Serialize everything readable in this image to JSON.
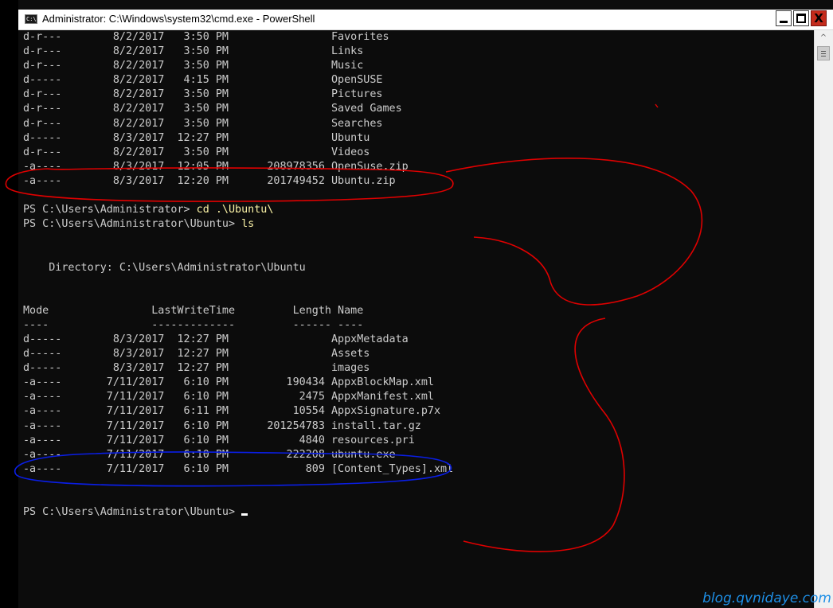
{
  "window": {
    "title": "Administrator: C:\\Windows\\system32\\cmd.exe - PowerShell",
    "title_icon_text": "C:\\",
    "close_glyph": "X"
  },
  "console": {
    "lines": [
      {
        "text": "d-r---        8/2/2017   3:50 PM                Favorites"
      },
      {
        "text": "d-r---        8/2/2017   3:50 PM                Links"
      },
      {
        "text": "d-r---        8/2/2017   3:50 PM                Music"
      },
      {
        "text": "d-----        8/2/2017   4:15 PM                OpenSUSE"
      },
      {
        "text": "d-r---        8/2/2017   3:50 PM                Pictures"
      },
      {
        "text": "d-r---        8/2/2017   3:50 PM                Saved Games"
      },
      {
        "text": "d-r---        8/2/2017   3:50 PM                Searches"
      },
      {
        "text": "d-----        8/3/2017  12:27 PM                Ubuntu"
      },
      {
        "text": "d-r---        8/2/2017   3:50 PM                Videos"
      },
      {
        "text": "-a----        8/3/2017  12:05 PM      208978356 OpenSuse.zip"
      },
      {
        "text": "-a----        8/3/2017  12:20 PM      201749452 Ubuntu.zip"
      },
      {
        "text": ""
      },
      {
        "text": "",
        "prompt": "PS C:\\Users\\Administrator> ",
        "command": "cd .\\Ubuntu\\"
      },
      {
        "text": "",
        "prompt": "PS C:\\Users\\Administrator\\Ubuntu> ",
        "command": "ls"
      },
      {
        "text": ""
      },
      {
        "text": ""
      },
      {
        "text": "    Directory: C:\\Users\\Administrator\\Ubuntu"
      },
      {
        "text": ""
      },
      {
        "text": ""
      },
      {
        "text": "Mode                LastWriteTime         Length Name"
      },
      {
        "text": "----                -------------         ------ ----"
      },
      {
        "text": "d-----        8/3/2017  12:27 PM                AppxMetadata"
      },
      {
        "text": "d-----        8/3/2017  12:27 PM                Assets"
      },
      {
        "text": "d-----        8/3/2017  12:27 PM                images"
      },
      {
        "text": "-a----       7/11/2017   6:10 PM         190434 AppxBlockMap.xml"
      },
      {
        "text": "-a----       7/11/2017   6:10 PM           2475 AppxManifest.xml"
      },
      {
        "text": "-a----       7/11/2017   6:11 PM          10554 AppxSignature.p7x"
      },
      {
        "text": "-a----       7/11/2017   6:10 PM      201254783 install.tar.gz"
      },
      {
        "text": "-a----       7/11/2017   6:10 PM           4840 resources.pri"
      },
      {
        "text": "-a----       7/11/2017   6:10 PM         222208 ubuntu.exe"
      },
      {
        "text": "-a----       7/11/2017   6:10 PM            809 [Content_Types].xml"
      },
      {
        "text": ""
      },
      {
        "text": ""
      },
      {
        "text": "",
        "prompt": "PS C:\\Users\\Administrator\\Ubuntu> ",
        "command": "",
        "cursor": true
      }
    ]
  },
  "scrollbar": {
    "up_arrow_glyph": "^"
  },
  "watermark": "blog.qvnidaye.com",
  "colors": {
    "console_background": "#0c0c0c",
    "console_text": "#cccccc",
    "command_text": "#f9f1a5",
    "red_annotation": "#e00000",
    "blue_annotation": "#0a1ee6",
    "watermark": "#1e8fe6"
  }
}
